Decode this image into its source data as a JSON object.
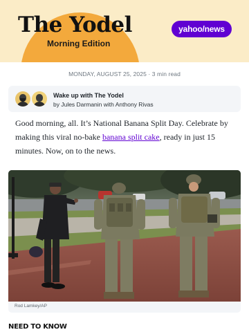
{
  "header": {
    "title": "The Yodel",
    "subtitle": "Morning Edition",
    "brand_logo": "yahoo/news",
    "brand_color": "#6001d2",
    "background_color": "#fbecc7",
    "sun_color": "#f3a93c"
  },
  "meta": {
    "dateline": "MONDAY, AUGUST 25, 2025 · 3 min read"
  },
  "author_card": {
    "title": "Wake up with The Yodel",
    "authors": "by Jules Darmanin with Anthony Rivas"
  },
  "intro": {
    "text_before_link": "Good morning, all. It’s National Banana Split Day. Celebrate by making this viral no-bake ",
    "link_text": "banana split cake",
    "text_after_link": ", ready in just 15 minutes. Now, on to the news."
  },
  "photo": {
    "credit": "Rod Lamkey/AP"
  },
  "sections": {
    "need_to_know": "NEED TO KNOW"
  }
}
